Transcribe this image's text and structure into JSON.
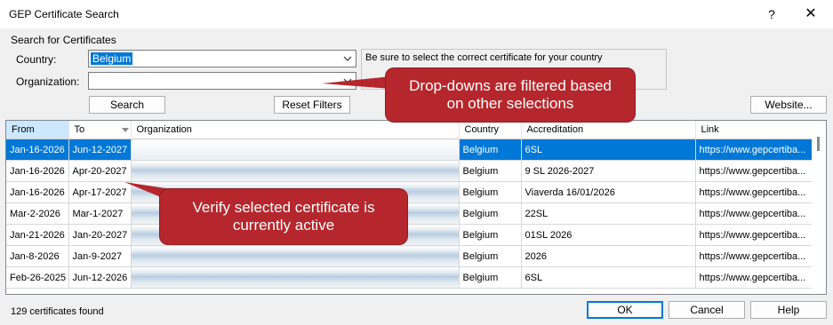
{
  "window": {
    "title": "GEP Certificate Search",
    "help_label": "?",
    "close_label": "✕"
  },
  "search": {
    "group_label": "Search for Certificates",
    "country_label": "Country:",
    "country_value": "Belgium",
    "organization_label": "Organization:",
    "organization_value": "",
    "hint": "Be sure to select the correct certificate for your country",
    "search_button": "Search",
    "reset_button": "Reset Filters",
    "website_button": "Website..."
  },
  "grid": {
    "columns": [
      "From",
      "To",
      "Organization",
      "Country",
      "Accreditation",
      "Link"
    ],
    "rows": [
      {
        "from": "Jan-16-2026",
        "to": "Jun-12-2027",
        "org": "",
        "country": "Belgium",
        "accreditation": "6SL",
        "link": "https://www.gepcertiba..."
      },
      {
        "from": "Jan-16-2026",
        "to": "Apr-20-2027",
        "org": "",
        "country": "Belgium",
        "accreditation": "9 SL 2026-2027",
        "link": "https://www.gepcertiba..."
      },
      {
        "from": "Jan-16-2026",
        "to": "Apr-17-2027",
        "org": "",
        "country": "Belgium",
        "accreditation": "Viaverda 16/01/2026",
        "link": "https://www.gepcertiba..."
      },
      {
        "from": "Mar-2-2026",
        "to": "Mar-1-2027",
        "org": "",
        "country": "Belgium",
        "accreditation": "22SL",
        "link": "https://www.gepcertiba..."
      },
      {
        "from": "Jan-21-2026",
        "to": "Jan-20-2027",
        "org": "",
        "country": "Belgium",
        "accreditation": "01SL 2026",
        "link": "https://www.gepcertiba..."
      },
      {
        "from": "Jan-8-2026",
        "to": "Jan-9-2027",
        "org": "",
        "country": "Belgium",
        "accreditation": "2026",
        "link": "https://www.gepcertiba..."
      },
      {
        "from": "Feb-26-2025",
        "to": "Jun-12-2026",
        "org": "",
        "country": "Belgium",
        "accreditation": "6SL",
        "link": "https://www.gepcertiba..."
      }
    ]
  },
  "callouts": {
    "dropdowns": "Drop-downs are filtered based on other selections",
    "verify": "Verify selected certificate is currently active"
  },
  "footer": {
    "status": "129 certificates found",
    "ok_button": "OK",
    "cancel_button": "Cancel",
    "help_button": "Help"
  },
  "colors": {
    "selection": "#0078d7",
    "callout": "#b5272d"
  }
}
